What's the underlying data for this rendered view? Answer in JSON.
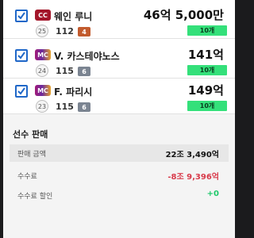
{
  "players": [
    {
      "name": "웨인 루니",
      "badge_text": "CC",
      "badge_icon": "season-cc-icon",
      "level": "25",
      "overall": "112",
      "grade": "4",
      "price": "46억 5,000만",
      "quantity": "10개",
      "checked": true
    },
    {
      "name": "V. 카스테야노스",
      "badge_text": "MC",
      "badge_icon": "season-mc-icon",
      "level": "24",
      "overall": "115",
      "grade": "6",
      "price": "141억",
      "quantity": "10개",
      "checked": true
    },
    {
      "name": "F. 파리시",
      "badge_text": "MC",
      "badge_icon": "season-mc-icon",
      "level": "23",
      "overall": "115",
      "grade": "6",
      "price": "149억",
      "quantity": "10개",
      "checked": true
    }
  ],
  "sale": {
    "title": "선수 판매",
    "rows": [
      {
        "label": "판매 금액",
        "value": "22조 3,490억"
      },
      {
        "label": "수수료",
        "value": "-8조 9,396억"
      },
      {
        "label": "수수료 할인",
        "value": "+0"
      }
    ]
  },
  "colors": {
    "accent": "#1f67c8",
    "quantity_badge": "#34e07a",
    "negative": "#d83a4a",
    "positive": "#1ec96a"
  }
}
